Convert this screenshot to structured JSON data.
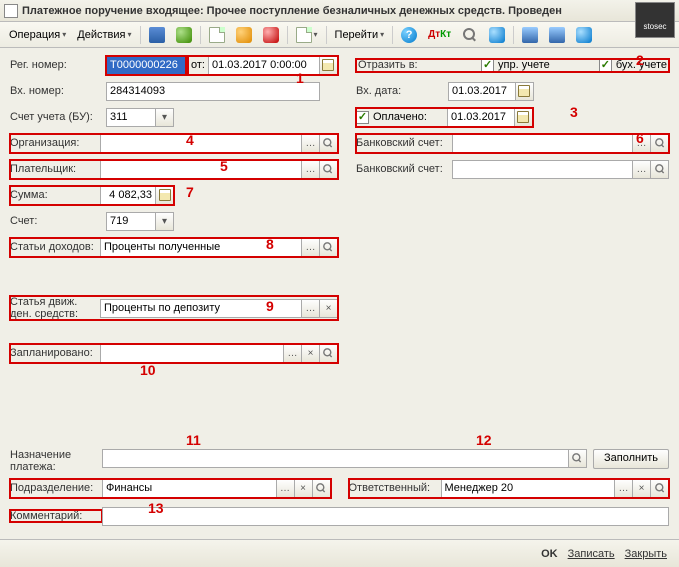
{
  "title": "Платежное поручение входящее: Прочее поступление безналичных денежных средств. Проведен",
  "logo_text": "stosec",
  "toolbar": {
    "operation": "Операция",
    "actions": "Действия",
    "go": "Перейти"
  },
  "labels": {
    "reg_no": "Рег. номер:",
    "from_date": "от:",
    "in_no": "Вх. номер:",
    "reflect_in": "Отразить в:",
    "upr": "упр. учете",
    "buh": "бух. учете",
    "in_date": "Вх. дата:",
    "account_bu": "Счет учета (БУ):",
    "paid": "Оплачено:",
    "org": "Организация:",
    "bank_acct": "Банковский счет:",
    "payer": "Плательщик:",
    "bank_acct2": "Банковский счет:",
    "sum": "Сумма:",
    "account": "Счет:",
    "income_items": "Статьи доходов:",
    "dds_item1": "Статья движ.",
    "dds_item2": "ден. средств:",
    "planned": "Запланировано:",
    "purpose1": "Назначение",
    "purpose2": "платежа:",
    "dept": "Подразделение:",
    "responsible": "Ответственный:",
    "comment": "Комментарий:",
    "fill": "Заполнить"
  },
  "values": {
    "reg_no": "Т0000000226",
    "from_date": "01.03.2017 0:00:00",
    "in_no": "284314093",
    "in_date": "01.03.2017",
    "account_bu": "311",
    "paid_date": "01.03.2017",
    "org": "",
    "bank_acct": "",
    "payer": "",
    "bank_acct2": "",
    "sum": "4 082,33",
    "account": "719",
    "income_items": "Проценты полученные",
    "dds_item": "Проценты по депозиту",
    "planned": "",
    "purpose": "",
    "dept": "Финансы",
    "responsible": "Менеджер 20",
    "comment": ""
  },
  "checks": {
    "upr": true,
    "buh": true,
    "paid": true
  },
  "annotations": {
    "a1": "1",
    "a2": "2",
    "a3": "3",
    "a4": "4",
    "a5": "5",
    "a6": "6",
    "a7": "7",
    "a8": "8",
    "a9": "9",
    "a10": "10",
    "a11": "11",
    "a12": "12",
    "a13": "13"
  },
  "bottom": {
    "ok": "OK",
    "save": "Записать",
    "close": "Закрыть"
  }
}
